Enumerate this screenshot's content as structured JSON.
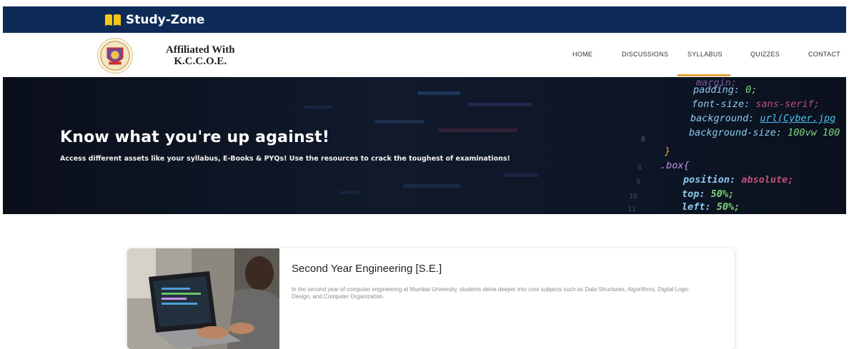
{
  "header": {
    "brand": "Study-Zone",
    "affiliation_line1": "Affiliated With",
    "affiliation_line2": "K.C.C.O.E."
  },
  "nav": {
    "items": [
      {
        "label": "HOME"
      },
      {
        "label": "DISCUSSIONS"
      },
      {
        "label": "SYLLABUS",
        "active": true
      },
      {
        "label": "QUIZZES"
      },
      {
        "label": "CONTACT"
      }
    ]
  },
  "hero": {
    "title": "Know what you're up against!",
    "subtitle": "Access different assets like your syllabus, E-Books & PYQs! Use the resources to crack the toughest of examinations!",
    "code_lines": [
      {
        "text": "margin:",
        "value": ""
      },
      {
        "text": "padding: ",
        "value": "0;"
      },
      {
        "text": "font-size: ",
        "value": "sans-serif;"
      },
      {
        "text": "background: ",
        "value": "url(Cyber.jpg"
      },
      {
        "text": "background-size: ",
        "value": "100vw 100"
      },
      {
        "text": "}",
        "value": ""
      },
      {
        "text": ".box{",
        "value": ""
      },
      {
        "text": "position: ",
        "value": "absolute;"
      },
      {
        "text": "top: ",
        "value": "50%;"
      },
      {
        "text": "left: ",
        "value": "50%;"
      }
    ],
    "line_numbers": [
      "6",
      "8",
      "9",
      "10",
      "11"
    ]
  },
  "card": {
    "title": "Second Year Engineering [S.E.]",
    "description": "In the second year of computer engineering at Mumbai University, students delve deeper into core subjects such as Data Structures, Algorithms, Digital Logic Design, and Computer Organization."
  },
  "colors": {
    "topbar": "#0e2a57",
    "accent": "#e7a23a",
    "brand_icon": "#f5c518",
    "code_keyword": "#4fc3f7",
    "code_value": "#c792ea",
    "code_number": "#7fd37a"
  }
}
